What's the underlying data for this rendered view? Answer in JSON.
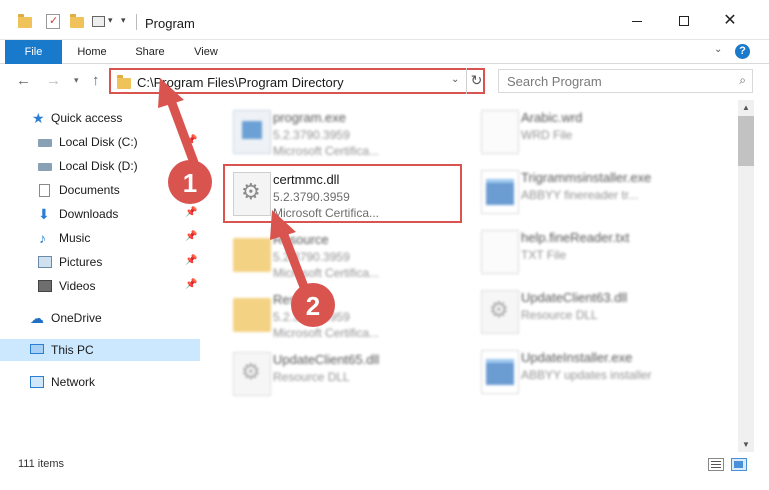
{
  "window": {
    "title": "Program",
    "minimize_icon": "minimize-icon",
    "maximize_icon": "maximize-icon",
    "close_icon": "close-icon"
  },
  "ribbon": {
    "tabs": [
      {
        "label": "File",
        "active": true
      },
      {
        "label": "Home"
      },
      {
        "label": "Share"
      },
      {
        "label": "View"
      }
    ],
    "help_label": "?"
  },
  "address": {
    "path": "C:\\Program Files\\Program Directory",
    "search_placeholder": "Search Program"
  },
  "sidebar": {
    "items": [
      {
        "label": "Quick access",
        "icon": "star-icon"
      },
      {
        "label": "Local Disk (C:)",
        "icon": "disk-icon",
        "pinned": true
      },
      {
        "label": "Local Disk (D:)",
        "icon": "disk-icon"
      },
      {
        "label": "Documents",
        "icon": "document-icon",
        "pinned": true
      },
      {
        "label": "Downloads",
        "icon": "download-icon",
        "pinned": true
      },
      {
        "label": "Music",
        "icon": "music-icon",
        "pinned": true
      },
      {
        "label": "Pictures",
        "icon": "picture-icon",
        "pinned": true
      },
      {
        "label": "Videos",
        "icon": "video-icon",
        "pinned": true
      },
      {
        "label": "OneDrive",
        "icon": "cloud-icon"
      },
      {
        "label": "This PC",
        "icon": "computer-icon",
        "selected": true
      },
      {
        "label": "Network",
        "icon": "network-icon"
      }
    ]
  },
  "files": {
    "left": [
      {
        "name": "program.exe",
        "line2": "5.2.3790.3959",
        "line3": "Microsoft Certifica...",
        "type": "exe",
        "blurred": true
      },
      {
        "name": "certmmc.dll",
        "line2": "5.2.3790.3959",
        "line3": "Microsoft Certifica...",
        "type": "dll",
        "blurred": false
      },
      {
        "name": "Resource",
        "line2": "5.2.3790.3959",
        "line3": "Microsoft Certifica...",
        "type": "folder",
        "blurred": true
      },
      {
        "name": "Resource",
        "line2": "5.2.3790.3959",
        "line3": "Microsoft Certifica...",
        "type": "folder",
        "blurred": true
      },
      {
        "name": "UpdateClient65.dll",
        "line2": "Resource DLL",
        "line3": "",
        "type": "dll",
        "blurred": true
      }
    ],
    "right": [
      {
        "name": "Arabic.wrd",
        "line2": "WRD File",
        "line3": "",
        "type": "txt"
      },
      {
        "name": "Trigrammsinstaller.exe",
        "line2": "ABBYY finereader tr...",
        "line3": "",
        "type": "app"
      },
      {
        "name": "help.fineReader.txt",
        "line2": "TXT File",
        "line3": "",
        "type": "txt"
      },
      {
        "name": "UpdateClient63.dll",
        "line2": "Resource DLL",
        "line3": "",
        "type": "dll"
      },
      {
        "name": "UpdateInstaller.exe",
        "line2": "ABBYY updates installer",
        "line3": "",
        "type": "app"
      }
    ]
  },
  "status": {
    "item_count": "111 items"
  },
  "annotations": {
    "badge1": "1",
    "badge2": "2",
    "color": "#d9534f"
  }
}
